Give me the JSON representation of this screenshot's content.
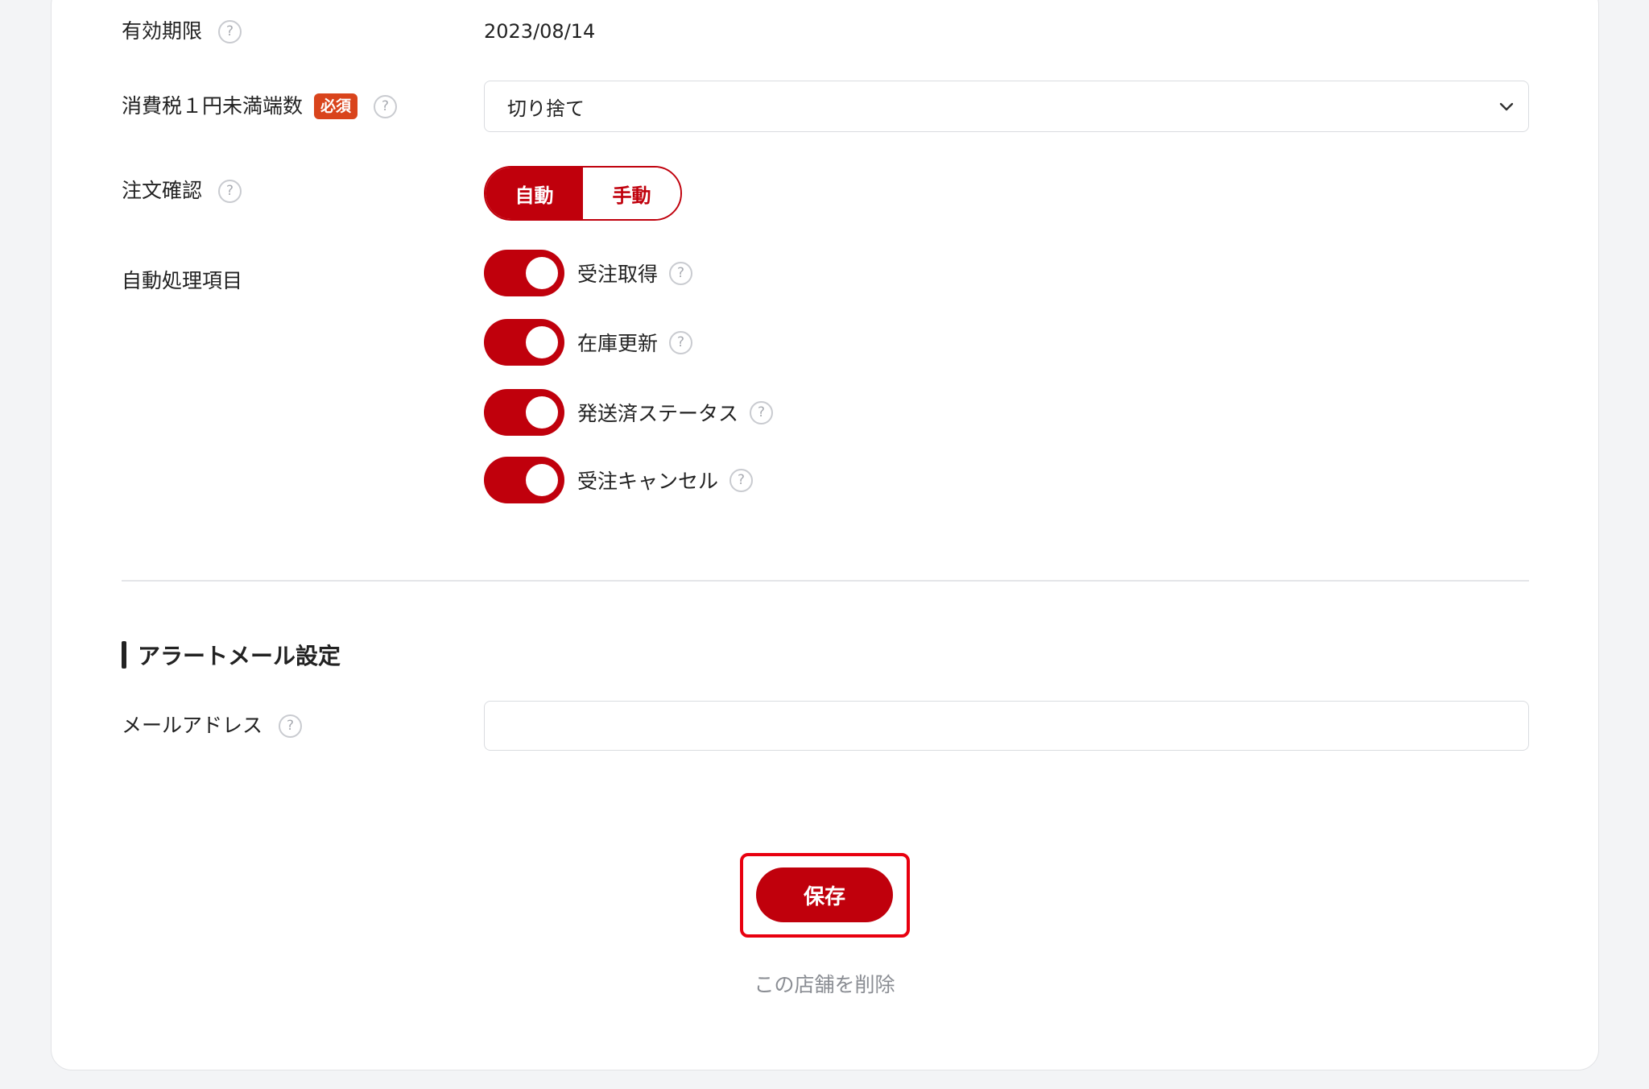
{
  "settings": {
    "expiry_label": "有効期限",
    "expiry_value": "2023/08/14",
    "tax_label": "消費税１円未満端数",
    "required_badge": "必須",
    "tax_selected": "切り捨て",
    "order_confirm_label": "注文確認",
    "order_confirm_options": [
      "自動",
      "手動"
    ],
    "auto_label": "自動処理項目",
    "auto_items": [
      {
        "label": "受注取得",
        "enabled": true
      },
      {
        "label": "在庫更新",
        "enabled": true
      },
      {
        "label": "発送済ステータス",
        "enabled": true
      },
      {
        "label": "受注キャンセル",
        "enabled": true
      }
    ]
  },
  "alert": {
    "section_title": "アラートメール設定",
    "email_label": "メールアドレス",
    "email_value": ""
  },
  "actions": {
    "save_label": "保存",
    "delete_label": "この店舗を削除"
  },
  "colors": {
    "accent": "#c0000c",
    "required_badge": "#d9441c",
    "highlight": "#e8000f"
  }
}
